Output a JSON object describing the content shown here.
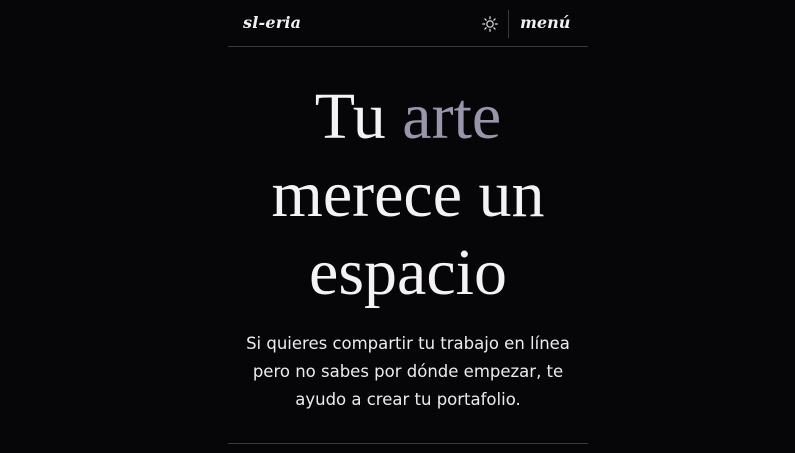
{
  "header": {
    "logo": "sl-eria",
    "theme_toggle_icon": "sun-icon",
    "menu_label": "menú"
  },
  "hero": {
    "title_part1": "Tu ",
    "title_accent": "arte",
    "title_part2": "merece un espacio",
    "subtitle": "Si quieres compartir tu trabajo en línea pero no sabes por dónde empezar, te ayudo a crear tu portafolio."
  },
  "colors": {
    "background": "#060507",
    "text": "#f2f0f2",
    "accent": "#9a95aa",
    "divider": "#3a383c"
  }
}
